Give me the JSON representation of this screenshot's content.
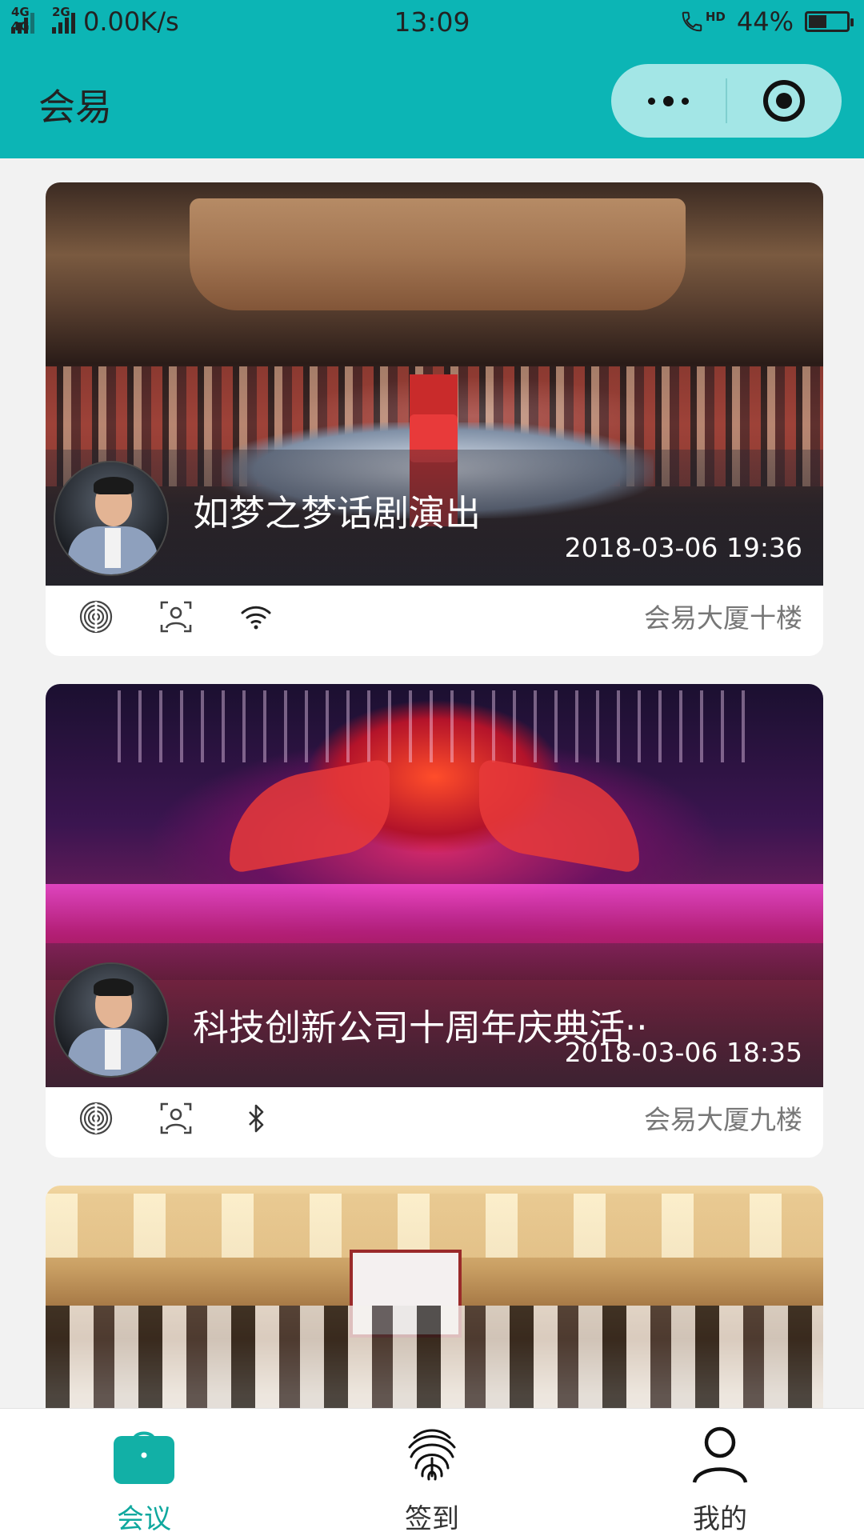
{
  "status_bar": {
    "net_tag1": "4G 4G",
    "net_tag2": "2G",
    "speed": "0.00K/s",
    "time": "13:09",
    "call_tag": "HD",
    "battery": "44%",
    "battery_level": 0.44
  },
  "header": {
    "title": "会易",
    "more_icon": "more-dots-icon",
    "close_icon": "target-circle-icon"
  },
  "colors": {
    "header_bg": "#0cb5b5",
    "capsule_bg": "#a3e6e6",
    "active_tab": "#0fa89e",
    "page_bg": "#f2f2f2"
  },
  "events": [
    {
      "title": "如梦之梦话剧演出",
      "time": "2018-03-06 19:36",
      "venue": "会易大厦十楼",
      "checkin_methods": [
        "fingerprint-icon",
        "face-scan-icon",
        "wifi-icon"
      ]
    },
    {
      "title": "科技创新公司十周年庆典活··",
      "time": "2018-03-06 18:35",
      "venue": "会易大厦九楼",
      "checkin_methods": [
        "fingerprint-icon",
        "face-scan-icon",
        "bluetooth-icon"
      ]
    },
    {
      "title": "",
      "time": "",
      "venue": "",
      "checkin_methods": []
    }
  ],
  "tabs": [
    {
      "label": "会议",
      "icon": "briefcase-icon",
      "active": true
    },
    {
      "label": "签到",
      "icon": "fingerprint-icon",
      "active": false
    },
    {
      "label": "我的",
      "icon": "person-icon",
      "active": false
    }
  ]
}
